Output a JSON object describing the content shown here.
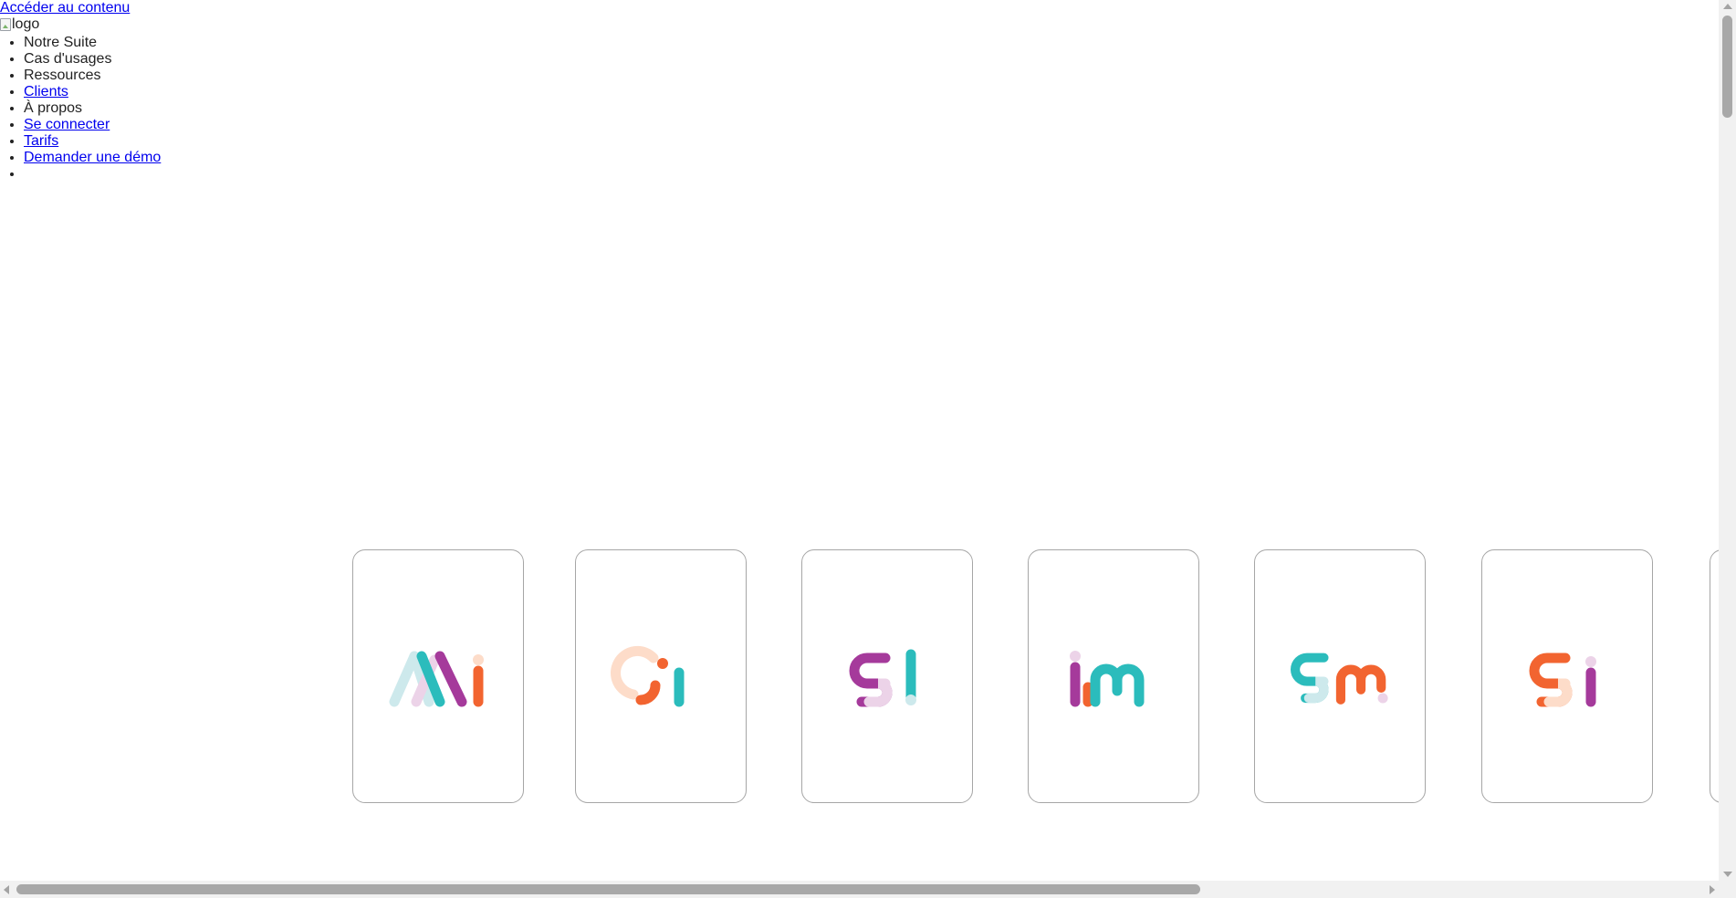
{
  "skip_link": {
    "label": "Accéder au contenu"
  },
  "header": {
    "logo_alt": "logo"
  },
  "nav": {
    "items": [
      {
        "label": "Notre Suite",
        "is_link": false
      },
      {
        "label": "Cas d'usages",
        "is_link": false
      },
      {
        "label": "Ressources",
        "is_link": false
      },
      {
        "label": "Clients",
        "is_link": true
      },
      {
        "label": "À propos",
        "is_link": false
      },
      {
        "label": "Se connecter",
        "is_link": true
      },
      {
        "label": "Tarifs",
        "is_link": true
      },
      {
        "label": "Demander une démo",
        "is_link": true
      },
      {
        "label": "",
        "is_link": false
      }
    ]
  },
  "product_cards": [
    {
      "logo": "mi-logo"
    },
    {
      "logo": "oi-logo"
    },
    {
      "logo": "si-logo-purple"
    },
    {
      "logo": "im-logo"
    },
    {
      "logo": "sm-logo"
    },
    {
      "logo": "si-logo-orange"
    },
    {
      "logo": "partial-card"
    }
  ],
  "colors": {
    "teal": "#2bbcbc",
    "purple": "#a53a9b",
    "orange": "#f26430",
    "light_teal": "#cde9ec",
    "light_pink": "#ecd3e8",
    "peach": "#fddcc9",
    "link": "#0000ee"
  }
}
